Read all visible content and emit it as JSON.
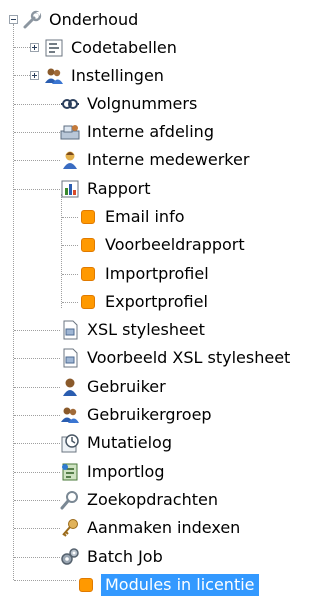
{
  "tree": {
    "root": {
      "label": "Onderhoud",
      "icon": "wrench-icon"
    },
    "items": [
      {
        "label": "Codetabellen",
        "icon": "codetable-icon",
        "expandable": true
      },
      {
        "label": "Instellingen",
        "icon": "users-icon",
        "expandable": true
      },
      {
        "label": "Volgnummers",
        "icon": "numbers-icon"
      },
      {
        "label": "Interne afdeling",
        "icon": "department-icon"
      },
      {
        "label": "Interne medewerker",
        "icon": "employee-icon"
      },
      {
        "label": "Rapport",
        "icon": "report-icon"
      },
      {
        "label": "Email info",
        "icon": "orange-square-icon",
        "child": true
      },
      {
        "label": "Voorbeeldrapport",
        "icon": "orange-square-icon",
        "child": true
      },
      {
        "label": "Importprofiel",
        "icon": "orange-square-icon",
        "child": true
      },
      {
        "label": "Exportprofiel",
        "icon": "orange-square-icon",
        "child": true
      },
      {
        "label": "XSL stylesheet",
        "icon": "xsl-document-icon"
      },
      {
        "label": "Voorbeeld XSL stylesheet",
        "icon": "xsl-document-icon"
      },
      {
        "label": "Gebruiker",
        "icon": "user-icon"
      },
      {
        "label": "Gebruikergroep",
        "icon": "users-icon"
      },
      {
        "label": "Mutatielog",
        "icon": "clock-log-icon"
      },
      {
        "label": "Importlog",
        "icon": "import-log-icon"
      },
      {
        "label": "Zoekopdrachten",
        "icon": "search-icon"
      },
      {
        "label": "Aanmaken indexen",
        "icon": "key-icon"
      },
      {
        "label": "Batch Job",
        "icon": "gears-icon"
      },
      {
        "label": "Modules in licentie",
        "icon": "orange-square-icon",
        "selected": true
      }
    ]
  },
  "colors": {
    "selection": "#3399ff",
    "orange": "#ff9900",
    "tree_line": "#a0a0a0"
  }
}
